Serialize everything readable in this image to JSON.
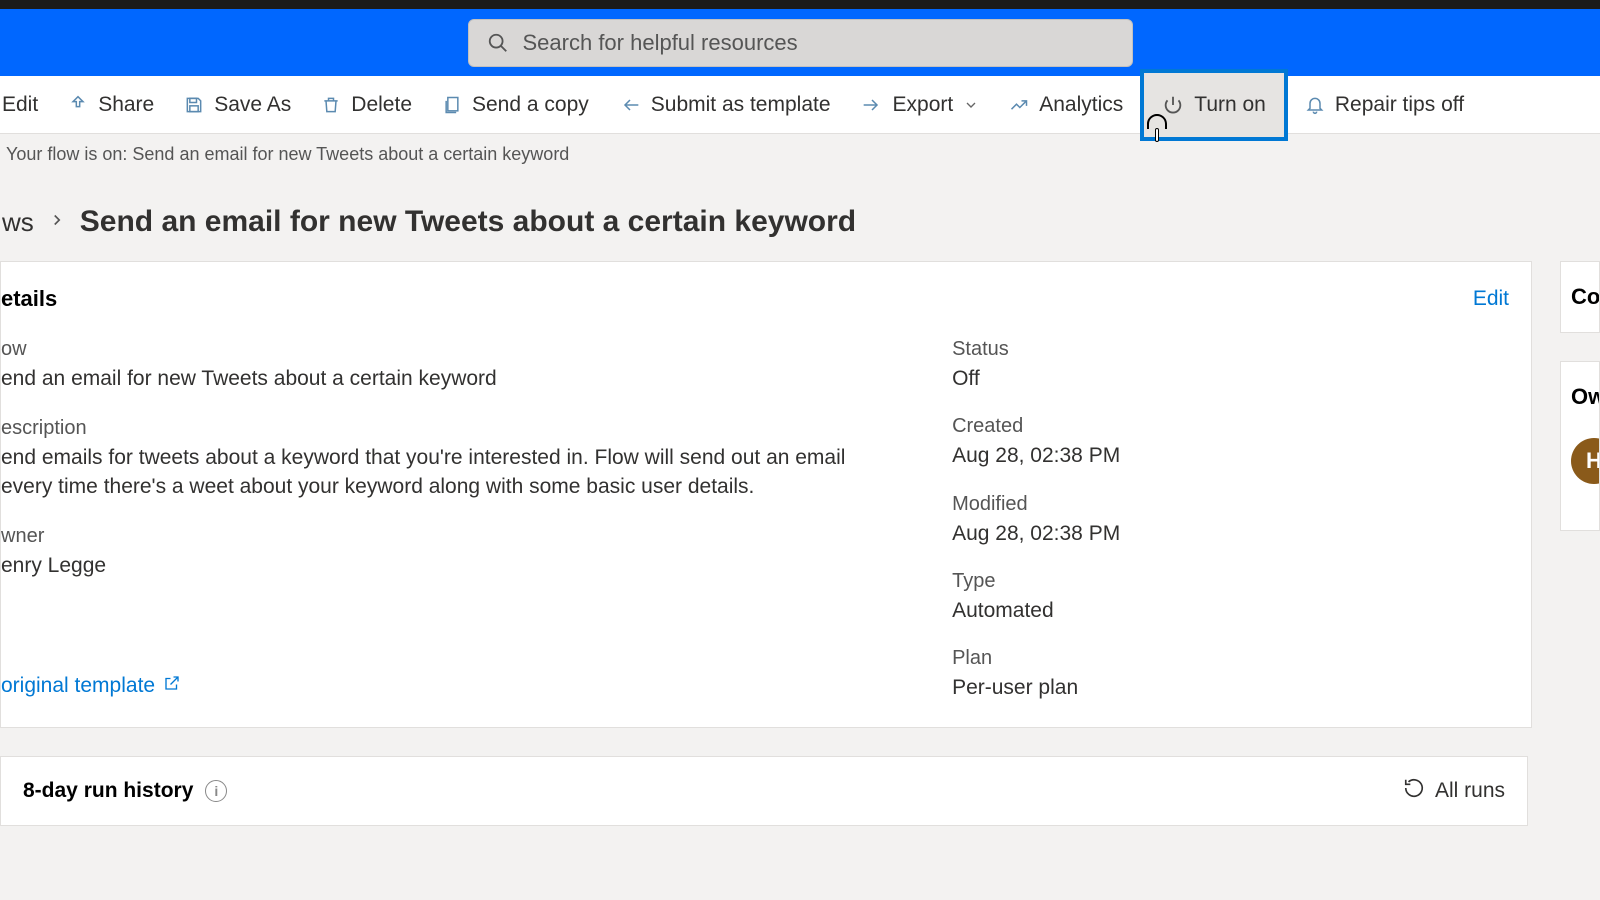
{
  "search": {
    "placeholder": "Search for helpful resources"
  },
  "toolbar": {
    "edit": "Edit",
    "share": "Share",
    "save_as": "Save As",
    "delete": "Delete",
    "send_copy": "Send a copy",
    "submit_template": "Submit as template",
    "export": "Export",
    "analytics": "Analytics",
    "turn_on": "Turn on",
    "repair_tips": "Repair tips off"
  },
  "status_line": "Your flow is on: Send an email for new Tweets about a certain keyword",
  "breadcrumb": {
    "root": "ws",
    "title": "Send an email for new Tweets about a certain keyword"
  },
  "details": {
    "card_title": "etails",
    "edit": "Edit",
    "flow_label": "ow",
    "flow_value": "end an email for new Tweets about a certain keyword",
    "desc_label": "escription",
    "desc_value": "end emails for tweets about a keyword that you're interested in. Flow will send out an email every time there's a weet about your keyword along with some basic user details.",
    "owner_label": "wner",
    "owner_value": "enry Legge",
    "status_label": "Status",
    "status_value": "Off",
    "created_label": "Created",
    "created_value": "Aug 28, 02:38 PM",
    "modified_label": "Modified",
    "modified_value": "Aug 28, 02:38 PM",
    "type_label": "Type",
    "type_value": "Automated",
    "plan_label": "Plan",
    "plan_value": "Per-user plan",
    "original_template": "original template"
  },
  "side": {
    "co": "Co",
    "ow": "Ow",
    "avatar": "H"
  },
  "history": {
    "title": "8-day run history",
    "info": "i",
    "all_runs": "All runs"
  }
}
